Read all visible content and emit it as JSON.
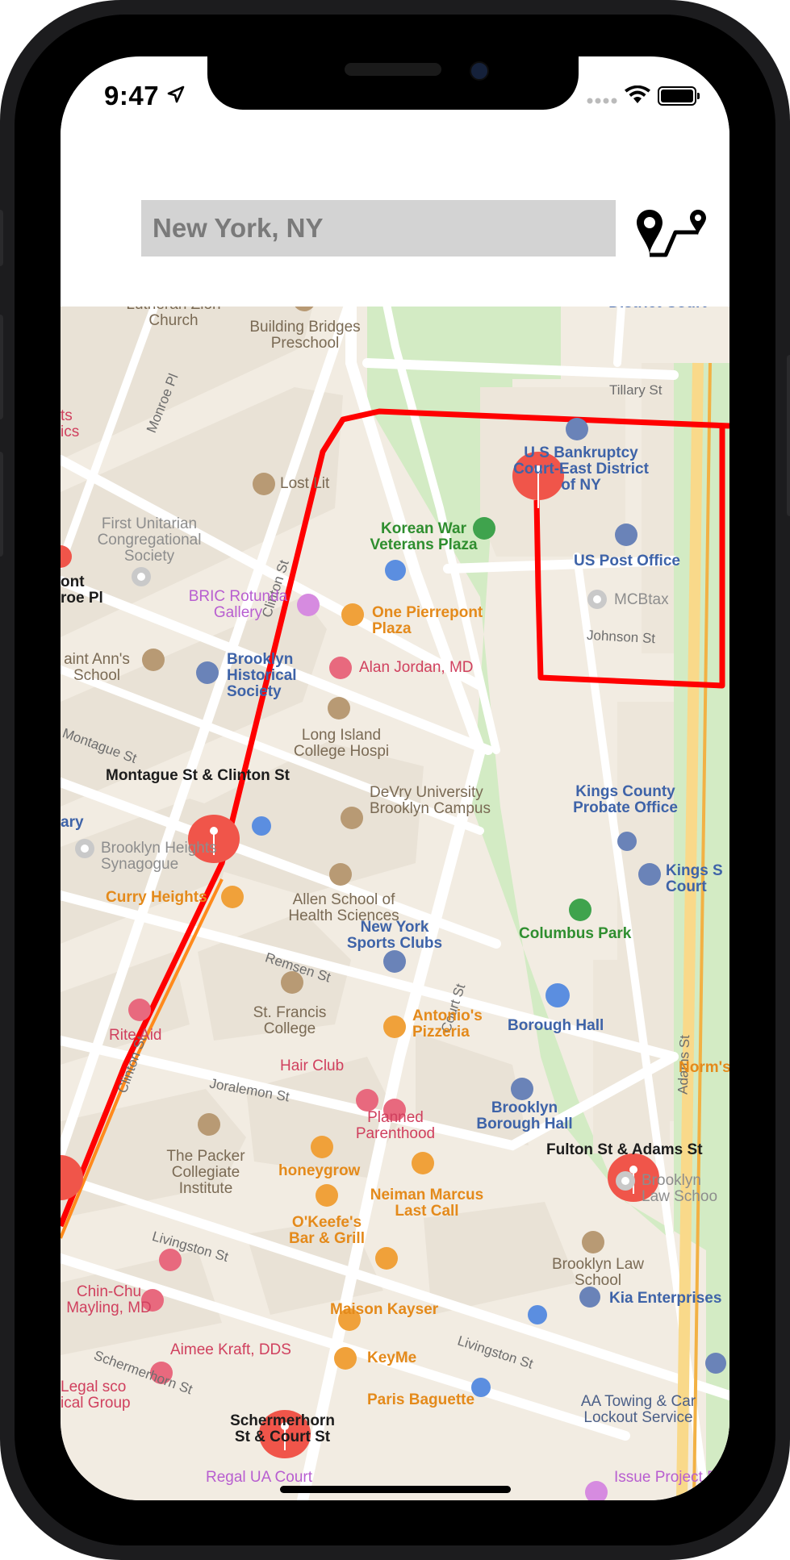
{
  "status_bar": {
    "time": "9:47"
  },
  "header": {
    "search_value": "New York, NY",
    "route_button_icon": "route-pins-icon"
  },
  "colors": {
    "route": "#ff0000",
    "pin": "#f0554a",
    "park": "#d3ebc4",
    "land": "#f2ece2"
  },
  "map": {
    "pins": [
      {
        "id": "pin-johnson",
        "label": ""
      },
      {
        "id": "pin-montague",
        "label": "Montague St & Clinton St"
      },
      {
        "id": "pin-fulton",
        "label": "Fulton St & Adams St"
      },
      {
        "id": "pin-schermerhorn",
        "label": "Schermerhorn St & Court St"
      }
    ],
    "streets": {
      "tillary": "Tillary St",
      "johnson": "Johnson St",
      "montague": "Montague St",
      "remsen": "Remsen St",
      "joralemon": "Joralemon St",
      "livingston1": "Livingston St",
      "livingston2": "Livingston St",
      "schermerhorn": "Schermerhorn St",
      "court": "Court St",
      "clinton1": "Clinton St",
      "clinton2": "Clinton St",
      "adams": "Adams St",
      "monroe": "Monroe Pl"
    },
    "pois": {
      "german_church": "German Evangelical Lutheran Zion Church",
      "building_bridges": "Building Bridges Preschool",
      "us_district_court": "United States District Court",
      "bankruptcy_court": "U S Bankruptcy Court-East District of NY",
      "lost_lit": "Lost Lit",
      "korean_war": "Korean War Veterans Plaza",
      "first_unitarian": "First Unitarian Congregational Society",
      "us_post_office": "US Post Office",
      "mcbtax": "MCBtax",
      "pierrepont_pl": "ont roe Pl",
      "bric": "BRIC Rotunda Gallery",
      "one_pierrepont": "One Pierrepont Plaza",
      "saint_anns": "aint Ann's School",
      "brooklyn_historical": "Brooklyn Historical Society",
      "alan_jordan": "Alan Jordan, MD",
      "long_island": "Long Island College Hospi",
      "devry": "DeVry University Brooklyn Campus",
      "kings_probate": "Kings County Probate Office",
      "kings_court": "Kings S Court",
      "bh_synagogue": "Brooklyn Heights Synagogue",
      "allen_school": "Allen School of Health Sciences",
      "curry_heights": "Curry Heights",
      "columbus_park": "Columbus Park",
      "ny_sports": "New York Sports Clubs",
      "st_francis": "St. Francis College",
      "antonios": "Antonio's Pizzeria",
      "rite_aid": "Rite Aid",
      "borough_hall_station": "Borough Hall",
      "hair_club": "Hair Club",
      "brooklyn_borough_hall": "Brooklyn Borough Hall",
      "norms": "Norm's",
      "planned_parenthood": "Planned Parenthood",
      "packer": "The Packer Collegiate Institute",
      "honeygrow": "honeygrow",
      "neiman": "Neiman Marcus Last Call",
      "bk_law_school_grey": "Brooklyn Law Schoo",
      "okeefes": "O'Keefe's Bar & Grill",
      "bk_law_school": "Brooklyn Law School",
      "chin_chu": "Chin-Chu Mayling, MD",
      "maison_kayser": "Maison Kayser",
      "aimee_kraft": "Aimee Kraft, DDS",
      "kia": "Kia Enterprises",
      "keyme": "KeyMe",
      "paris_baguette": "Paris Baguette",
      "aa_towing": "AA Towing & Car Lockout Service",
      "legal_medical": "Legal sco ical Group",
      "regal": "Regal UA Court",
      "issue_project": "Issue Project R",
      "ists": "ts ics",
      "ary": "ary"
    }
  }
}
